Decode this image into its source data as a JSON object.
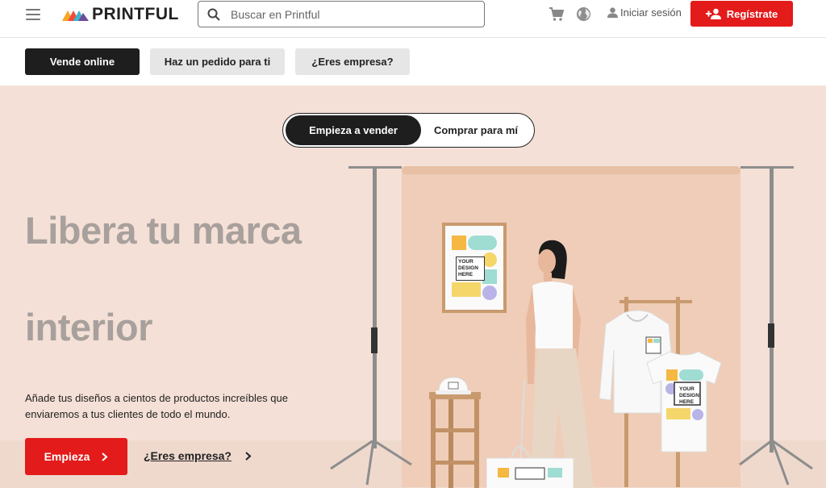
{
  "header": {
    "logo_text": "PRINTFUL",
    "search_placeholder": "Buscar en Printful",
    "login_label": "Iniciar sesión",
    "register_label": "Regístrate"
  },
  "subnav": {
    "items": [
      "Vende online",
      "Haz un pedido para ti",
      "¿Eres empresa?"
    ]
  },
  "hero": {
    "toggle": [
      "Empieza a vender",
      "Comprar para mí"
    ],
    "headline_line1": "Libera tu marca",
    "headline_line2": "interior",
    "description": "Añade tus diseños a cientos de productos increíbles que enviaremos a tus clientes de todo el mundo.",
    "cta_primary": "Empieza",
    "cta_secondary": "¿Eres empresa?",
    "mockup_text": "YOUR DESIGN HERE"
  },
  "colors": {
    "brand_red": "#e31b1b",
    "dark": "#1e1e1e",
    "hero_bg": "#f4e0d6",
    "headline": "#a8a09c"
  },
  "icons": [
    "menu-icon",
    "search-icon",
    "cart-icon",
    "globe-icon",
    "user-icon",
    "add-user-icon",
    "chevron-right-icon"
  ]
}
